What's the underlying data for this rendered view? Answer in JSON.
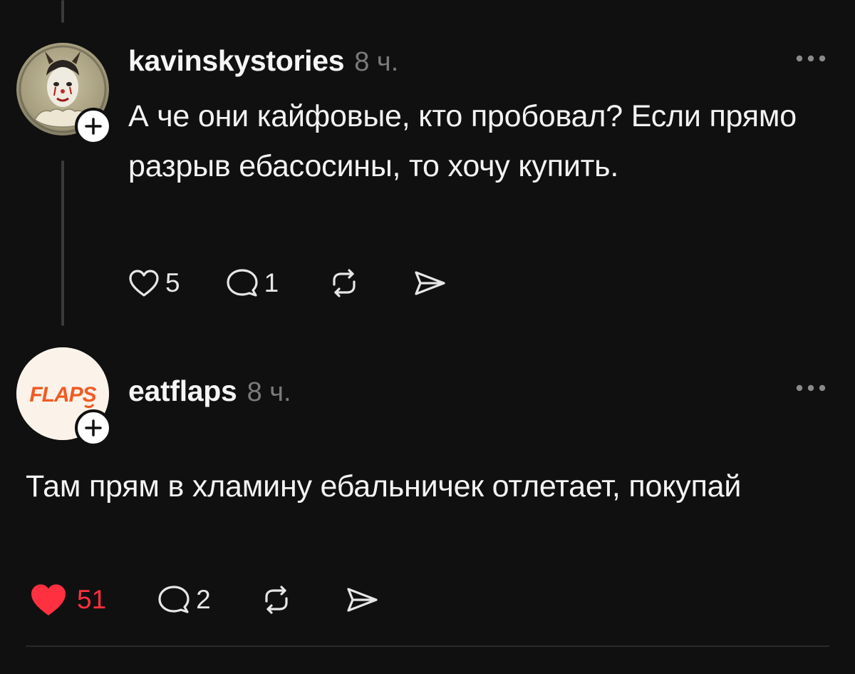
{
  "posts": [
    {
      "username": "kavinskystories",
      "time": "8 ч.",
      "text": "А че они кайфовые, кто пробовал? Если прямо разрыв ебасосины, то хочу купить.",
      "likes": "5",
      "replies": "1",
      "liked": false
    },
    {
      "username": "eatflaps",
      "time": "8 ч.",
      "text": "Там прям в хламину ебальничек отлетает, покупай",
      "likes": "51",
      "replies": "2",
      "liked": true,
      "avatar_logo": "FLAPS"
    }
  ],
  "colors": {
    "background": "#101010",
    "liked": "#ff3040",
    "muted": "#7a7a7a",
    "flaps_orange": "#f15a22"
  }
}
